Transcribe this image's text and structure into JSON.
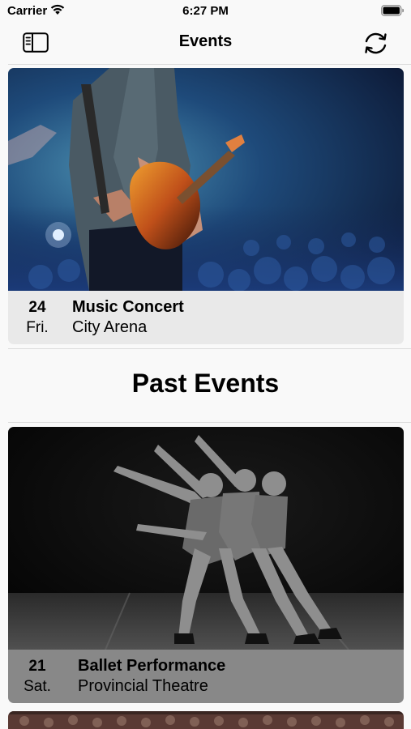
{
  "status_bar": {
    "carrier": "Carrier",
    "time": "6:27 PM"
  },
  "nav": {
    "title": "Events"
  },
  "upcoming_events": [
    {
      "day": "24",
      "weekday": "Fri.",
      "name": "Music Concert",
      "venue": "City Arena"
    }
  ],
  "past_section": {
    "title": "Past Events"
  },
  "past_events": [
    {
      "day": "21",
      "weekday": "Sat.",
      "name": "Ballet Performance",
      "venue": "Provincial Theatre"
    }
  ],
  "icons": {
    "sidebar": "sidebar-toggle-icon",
    "refresh": "refresh-arrows-icon",
    "wifi": "wifi-icon",
    "battery": "battery-icon"
  },
  "colors": {
    "background": "#f9f9f9",
    "upcoming_info_bg": "#e9e9e9",
    "past_info_bg": "#888888"
  }
}
